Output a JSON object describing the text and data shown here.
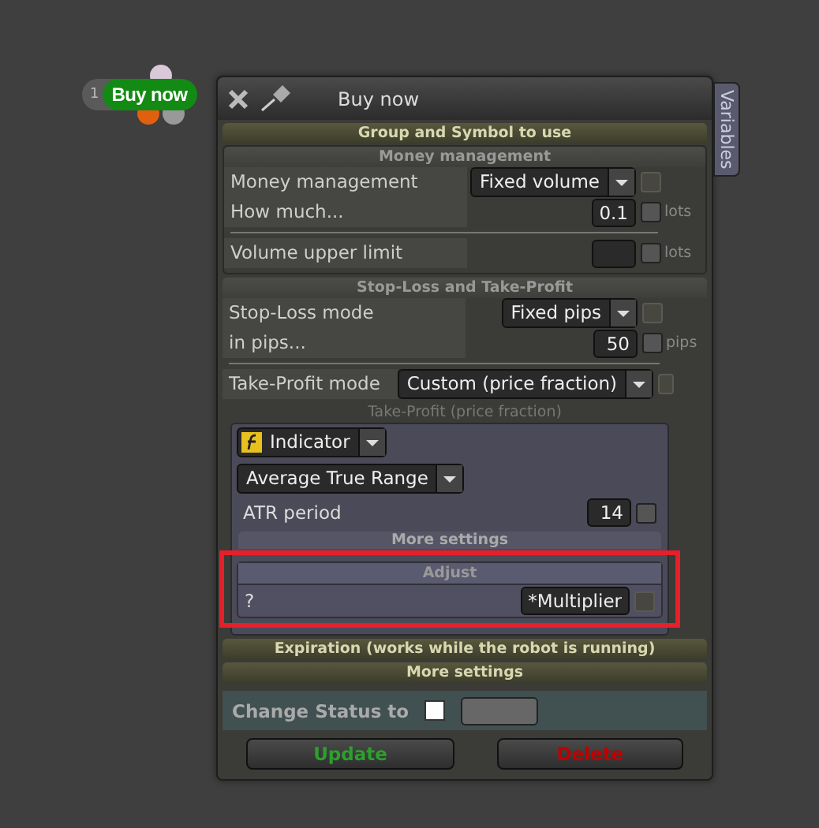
{
  "badge": {
    "number": "1",
    "label": "Buy now"
  },
  "window": {
    "title": "Buy now"
  },
  "side_tab": "Variables",
  "group_header": "Group and Symbol to use",
  "money": {
    "title": "Money management",
    "rows": [
      {
        "kind": "select",
        "label": "Money management",
        "value": "Fixed volume",
        "checked": false
      },
      {
        "kind": "number",
        "label": "How much...",
        "value": "0.1",
        "unit": "lots",
        "checked": false
      },
      {
        "kind": "divider"
      },
      {
        "kind": "number",
        "label": "Volume upper limit",
        "unit": "lots",
        "checked": false
      }
    ]
  },
  "stoploss": {
    "title": "Stop-Loss and Take-Profit",
    "rows": [
      {
        "kind": "select",
        "label": "Stop-Loss mode",
        "value": "Fixed pips",
        "checked": false
      },
      {
        "kind": "number",
        "label": "in pips...",
        "value": "50",
        "unit": "pips",
        "checked": false
      },
      {
        "kind": "divider"
      },
      {
        "kind": "select",
        "label": "Take-Profit mode",
        "value": "Custom (price fraction)",
        "checked": false
      }
    ]
  },
  "take_profit": {
    "caption": "Take-Profit (price fraction)",
    "source": "Indicator",
    "indicator": "Average True Range",
    "params": [
      {
        "label": "ATR period",
        "value": "14",
        "checked": false
      }
    ],
    "more_settings": "More settings",
    "adjust": {
      "title": "Adjust",
      "label": "?",
      "value": "*Multiplier",
      "checked": false
    }
  },
  "collapsed": [
    "Expiration (works while the robot is running)",
    "More settings"
  ],
  "status": {
    "label": "Change Status to",
    "checked": false
  },
  "buttons": [
    {
      "kind": "update",
      "label": "Update"
    },
    {
      "kind": "delete",
      "label": "Delete"
    }
  ]
}
